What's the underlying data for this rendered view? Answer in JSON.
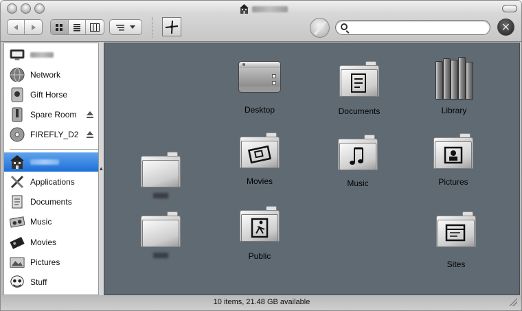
{
  "window": {
    "status_text": "10 items, 21.48 GB available"
  },
  "toolbar": {
    "search_placeholder": "",
    "view_modes": [
      "icon",
      "list",
      "column"
    ],
    "active_view": "icon",
    "close_label": "✕"
  },
  "sidebar": {
    "items": [
      {
        "label": "",
        "icon": "monitor-icon",
        "blurred": true
      },
      {
        "label": "Network",
        "icon": "globe-icon"
      },
      {
        "label": "Gift Horse",
        "icon": "apple-disk-icon"
      },
      {
        "label": "Spare Room",
        "icon": "zip-drive-icon",
        "eject": true
      },
      {
        "label": "FIREFLY_D2",
        "icon": "dvd-icon",
        "eject": true
      },
      {
        "label": "",
        "icon": "home-icon",
        "blurred": true,
        "selected": true
      },
      {
        "label": "Applications",
        "icon": "tools-icon"
      },
      {
        "label": "Documents",
        "icon": "documents-icon"
      },
      {
        "label": "Music",
        "icon": "music-icon"
      },
      {
        "label": "Movies",
        "icon": "movies-icon"
      },
      {
        "label": "Pictures",
        "icon": "pictures-icon"
      },
      {
        "label": "Stuff",
        "icon": "skull-icon"
      }
    ]
  },
  "files": [
    {
      "label": "Desktop",
      "icon": "desktop-icon"
    },
    {
      "label": "Documents",
      "icon": "documents-folder-icon"
    },
    {
      "label": "Library",
      "icon": "library-books-icon"
    },
    {
      "label": "",
      "icon": "folder-icon",
      "blurred": true
    },
    {
      "label": "Movies",
      "icon": "movies-folder-icon"
    },
    {
      "label": "Music",
      "icon": "music-folder-icon"
    },
    {
      "label": "Pictures",
      "icon": "pictures-folder-icon"
    },
    {
      "label": "",
      "icon": "folder-icon",
      "blurred": true
    },
    {
      "label": "Public",
      "icon": "public-folder-icon"
    },
    {
      "label": "Sites",
      "icon": "sites-folder-icon"
    }
  ],
  "colors": {
    "content_bg": "#5f6a73",
    "selection": "#1f6fd8"
  }
}
